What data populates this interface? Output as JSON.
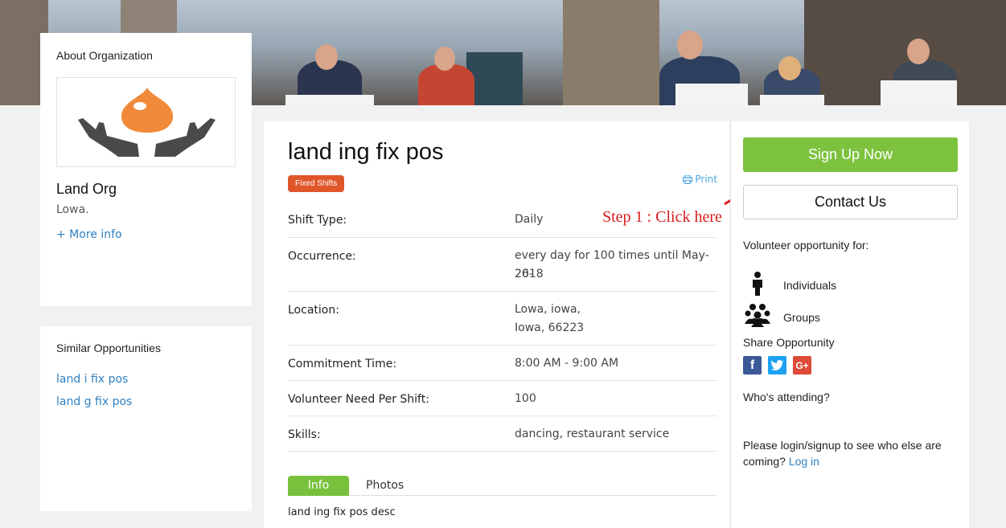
{
  "about": {
    "title": "About Organization",
    "org_name": "Land Org",
    "org_location": "Lowa.",
    "more_info": "+ More info"
  },
  "similar": {
    "title": "Similar Opportunities",
    "links": [
      "land i fix pos",
      "land g fix pos"
    ]
  },
  "opportunity": {
    "title": "land ing fix pos",
    "badge": "Fixed Shifts",
    "print": "Print",
    "details": [
      {
        "label": "Shift Type:",
        "value_lines": [
          "Daily"
        ]
      },
      {
        "label": "Occurrence:",
        "value_lines": [
          "every day for 100 times until May-26-",
          "2018"
        ]
      },
      {
        "label": "Location:",
        "value_lines": [
          "Lowa, iowa,",
          "Iowa, 66223"
        ]
      },
      {
        "label": "Commitment Time:",
        "value_lines": [
          "8:00 AM - 9:00 AM"
        ]
      },
      {
        "label": "Volunteer Need Per Shift:",
        "value_lines": [
          "100"
        ]
      },
      {
        "label": "Skills:",
        "value_lines": [
          "dancing, restaurant service"
        ]
      }
    ],
    "tabs": [
      "Info",
      "Photos"
    ],
    "description": "land ing fix pos desc"
  },
  "annotation": "Step 1 : Click here",
  "sidebar": {
    "signup": "Sign Up Now",
    "contact": "Contact Us",
    "volunteer_for": "Volunteer opportunity for:",
    "individuals": "Individuals",
    "groups": "Groups",
    "share": "Share Opportunity",
    "attending": "Who's attending?",
    "login_text": "Please login/signup to see who else are coming?",
    "login_link": "Log in"
  },
  "colors": {
    "signup_green": "#7dc23f",
    "badge_orange": "#e0562b",
    "link_blue": "#2e7fbf",
    "facebook": "#3b5998",
    "twitter": "#1da1f2",
    "google": "#dd4b39"
  },
  "icons": [
    "print-icon",
    "individual-icon",
    "group-icon",
    "facebook-icon",
    "twitter-icon",
    "google-plus-icon",
    "org-logo"
  ]
}
